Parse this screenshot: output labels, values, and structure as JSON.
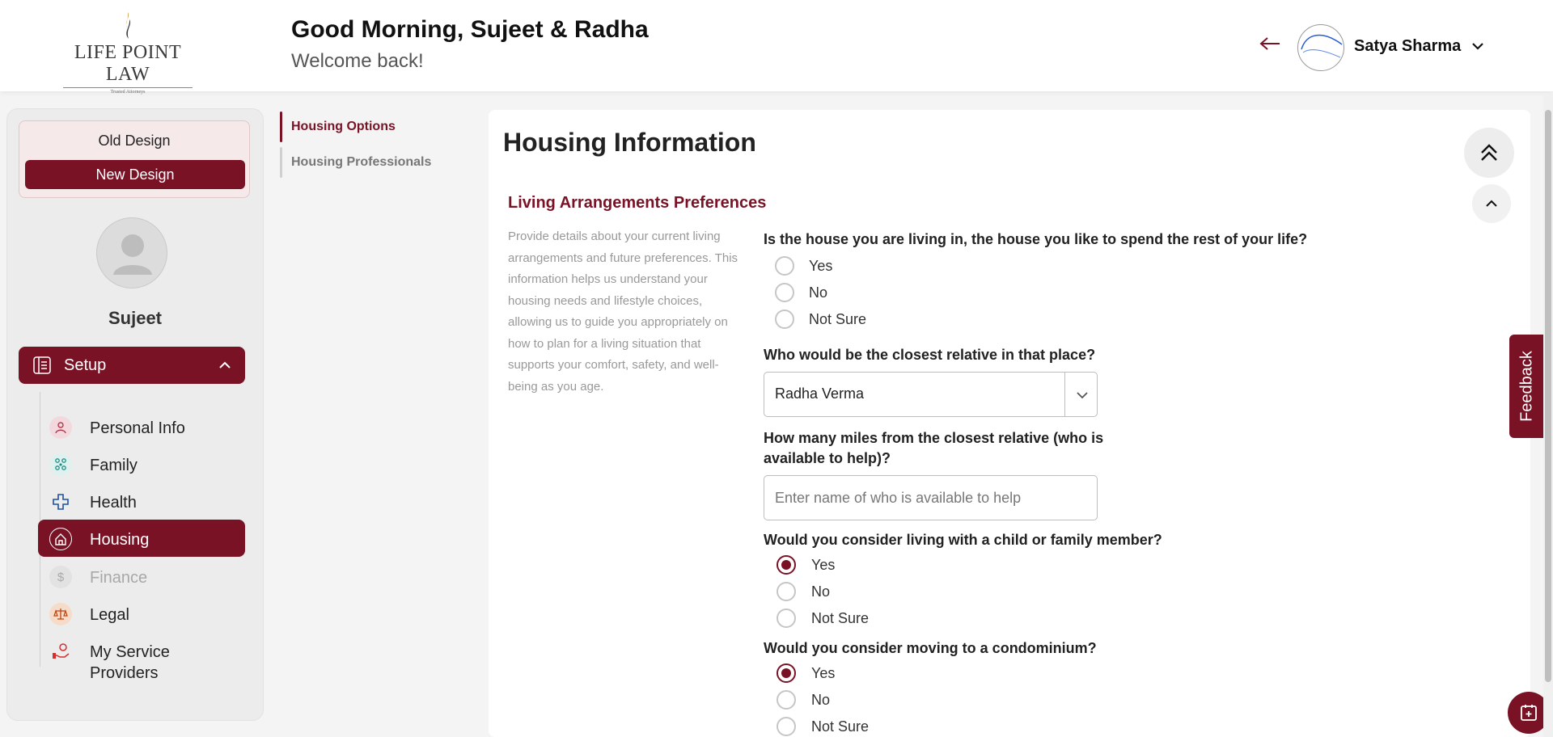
{
  "brand": {
    "name": "LIFE POINT LAW",
    "tagline": "Trusted Attorneys"
  },
  "header": {
    "greeting": "Good Morning, Sujeet & Radha",
    "welcome": "Welcome back!",
    "user_name": "Satya Sharma"
  },
  "sidebar": {
    "old_design": "Old Design",
    "new_design": "New Design",
    "profile_name": "Sujeet",
    "setup_label": "Setup",
    "items": [
      {
        "label": "Personal Info",
        "icon": "person-icon",
        "state": "normal"
      },
      {
        "label": "Family",
        "icon": "family-icon",
        "state": "normal"
      },
      {
        "label": "Health",
        "icon": "health-cross-icon",
        "state": "normal"
      },
      {
        "label": "Housing",
        "icon": "house-icon",
        "state": "active"
      },
      {
        "label": "Finance",
        "icon": "dollar-icon",
        "state": "disabled"
      },
      {
        "label": "Legal",
        "icon": "scales-icon",
        "state": "normal"
      },
      {
        "label": "My Service Providers",
        "icon": "service-hand-icon",
        "state": "normal"
      }
    ]
  },
  "subnav": {
    "items": [
      {
        "label": "Housing Options",
        "active": true
      },
      {
        "label": "Housing Professionals",
        "active": false
      }
    ]
  },
  "main": {
    "title": "Housing Information",
    "section_title": "Living Arrangements Preferences",
    "section_desc": "Provide details about your current living arrangements and future preferences. This information helps us understand your housing needs and lifestyle choices, allowing us to guide you appropriately on how to plan for a living situation that supports your comfort, safety, and well-being as you age.",
    "q1": {
      "text": "Is the house you are living in, the house you like to spend the rest of your life?",
      "options": [
        "Yes",
        "No",
        "Not Sure"
      ],
      "selected": null
    },
    "q2": {
      "text": "Who would be the closest relative in that place?",
      "value": "Radha Verma"
    },
    "q3": {
      "text_line1": "How many miles from the closest relative (who is",
      "text_line2": "available to help)?",
      "placeholder": "Enter name of who is available to help"
    },
    "q4": {
      "text": "Would you consider living with a child or family member?",
      "options": [
        "Yes",
        "No",
        "Not Sure"
      ],
      "selected": "Yes"
    },
    "q5": {
      "text": "Would you consider moving to a condominium?",
      "options": [
        "Yes",
        "No",
        "Not Sure"
      ],
      "selected": "Yes"
    }
  },
  "feedback_label": "Feedback",
  "colors": {
    "accent": "#7a1226"
  }
}
